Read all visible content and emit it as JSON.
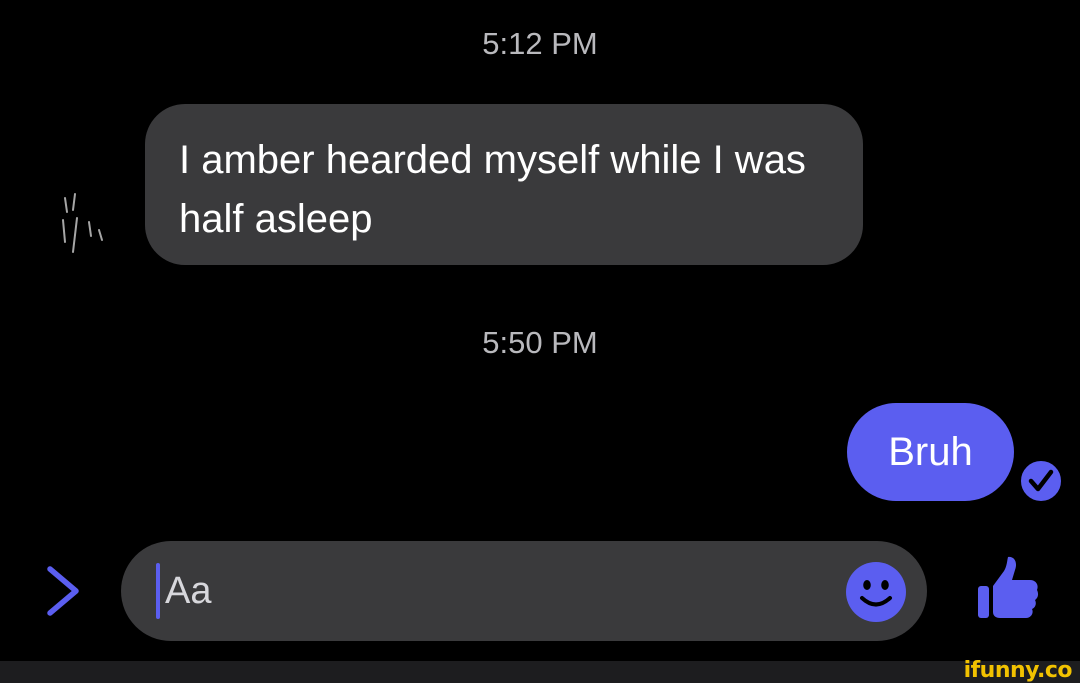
{
  "conversation": {
    "messages": [
      {
        "timestamp": "5:12 PM",
        "direction": "incoming",
        "text": "I amber hearded myself while I was half asleep"
      },
      {
        "timestamp": "5:50 PM",
        "direction": "outgoing",
        "text": "Bruh",
        "status_icon": "read-receipt-check-icon"
      }
    ]
  },
  "composer": {
    "placeholder": "Aa",
    "expand_icon": "chevron-right-icon",
    "emoji_icon": "smiley-face-icon",
    "send_icon": "thumbs-up-icon"
  },
  "watermark": {
    "text": "ifunny.co"
  },
  "colors": {
    "background": "#000000",
    "incoming_bubble": "#3a3a3c",
    "outgoing_bubble": "#5b5ef0",
    "accent": "#5b5ef0",
    "timestamp_text": "#b9b9bd",
    "watermark": "#f2c200"
  }
}
